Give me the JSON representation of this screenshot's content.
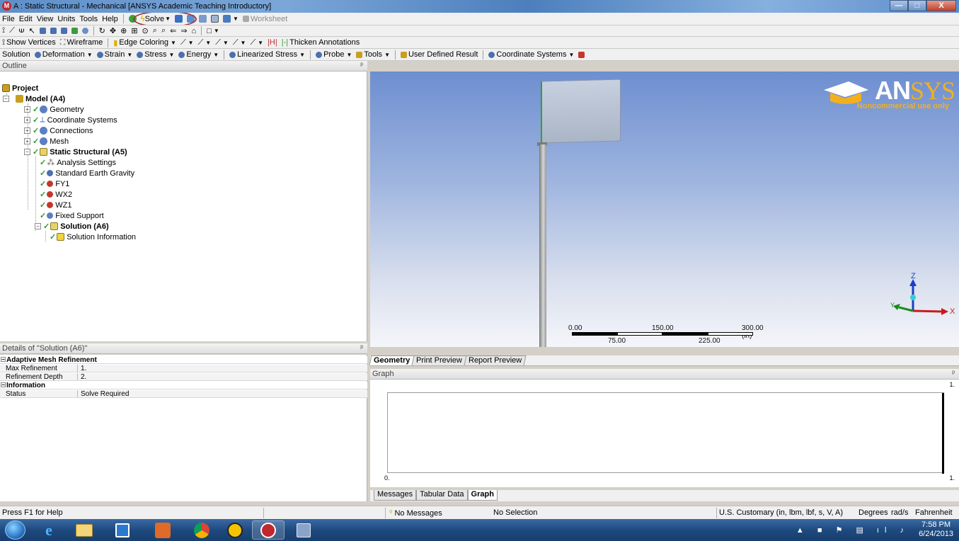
{
  "window": {
    "title": "A : Static Structural - Mechanical [ANSYS Academic Teaching Introductory]",
    "app_icon_letter": "M",
    "controls": {
      "minimize": "—",
      "maximize": "□",
      "close": "X"
    }
  },
  "menu": [
    "File",
    "Edit",
    "View",
    "Units",
    "Tools",
    "Help"
  ],
  "toolbar_main": {
    "solve_label": "Solve",
    "worksheet_label": "Worksheet"
  },
  "toolbar_graphics": {
    "show_vertices": "Show Vertices",
    "wireframe": "Wireframe",
    "edge_coloring": "Edge Coloring",
    "thicken_annotations": "Thicken Annotations"
  },
  "toolbar_solution": {
    "solution": "Solution",
    "deformation": "Deformation",
    "strain": "Strain",
    "stress": "Stress",
    "energy": "Energy",
    "linearized_stress": "Linearized Stress",
    "probe": "Probe",
    "tools": "Tools",
    "user_defined_result": "User Defined Result",
    "coordinate_systems": "Coordinate Systems"
  },
  "outline": {
    "header": "Outline",
    "pin": "ᵖ",
    "items": [
      {
        "label": "Project"
      },
      {
        "label": "Model (A4)"
      },
      {
        "label": "Geometry"
      },
      {
        "label": "Coordinate Systems"
      },
      {
        "label": "Connections"
      },
      {
        "label": "Mesh"
      },
      {
        "label": "Static Structural (A5)"
      },
      {
        "label": "Analysis Settings"
      },
      {
        "label": "Standard Earth Gravity"
      },
      {
        "label": "FY1"
      },
      {
        "label": "WX2"
      },
      {
        "label": "WZ1"
      },
      {
        "label": "Fixed Support"
      },
      {
        "label": "Solution (A6)"
      },
      {
        "label": "Solution Information"
      }
    ]
  },
  "details": {
    "header": "Details of \"Solution (A6)\"",
    "sections": [
      {
        "title": "Adaptive Mesh Refinement",
        "rows": [
          {
            "name": "Max Refinement Loops",
            "value": "1."
          },
          {
            "name": "Refinement Depth",
            "value": "2."
          }
        ]
      },
      {
        "title": "Information",
        "rows": [
          {
            "name": "Status",
            "value": "Solve Required"
          }
        ]
      }
    ]
  },
  "viewport": {
    "logo_text_an": "AN",
    "logo_text_sys": "SYS",
    "logo_sub": "Noncommercial use only",
    "scale": {
      "top_labels": [
        "0.00",
        "150.00",
        "300.00 (in)"
      ],
      "bottom_labels": [
        "75.00",
        "225.00"
      ]
    },
    "axes": {
      "z": "Z",
      "x": "X",
      "y": "Y"
    }
  },
  "view_tabs": [
    "Geometry",
    "Print Preview",
    "Report Preview"
  ],
  "graph": {
    "header": "Graph",
    "y_top_right": "1.",
    "x_left": "0.",
    "x_right": "1."
  },
  "bottom_tabs": [
    "Messages",
    "Tabular Data",
    "Graph"
  ],
  "status": {
    "help": "Press F1 for Help",
    "messages": "No Messages",
    "selection": "No Selection",
    "units": "U.S. Customary (in, lbm, lbf, s, V, A)",
    "angle": "Degrees",
    "rot_velocity": "rad/s",
    "temperature": "Fahrenheit"
  },
  "taskbar": {
    "time": "7:58 PM",
    "date": "6/24/2013"
  }
}
